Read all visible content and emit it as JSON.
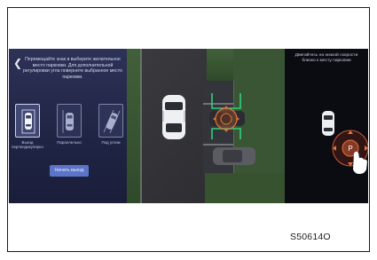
{
  "left_panel": {
    "back_icon": "chevron-left-icon",
    "instruction": "Перемещайте знак и выберите желательное место парковки. Для дополнительной регулировки угла поверните выбранное место парковки.",
    "modes": [
      {
        "label": "Выезд перпендикулярно",
        "icon": "perpendicular-parking-icon",
        "active": true
      },
      {
        "label": "Параллельно",
        "icon": "parallel-parking-icon",
        "active": false
      },
      {
        "label": "Под углом",
        "icon": "angled-parking-icon",
        "active": false
      }
    ],
    "start_button": "Начать выезд"
  },
  "camera_view": {
    "target_icon": "parking-target-icon",
    "slot_line_color": "#2ed17a",
    "target_color": "#e8743a"
  },
  "right_panel": {
    "hint": "Двигайтесь на низкой скорости близко к месту парковки",
    "control_icon": "parking-direction-control-icon",
    "hand_icon": "hand-pointer-icon"
  },
  "figure_code": "S50614O"
}
